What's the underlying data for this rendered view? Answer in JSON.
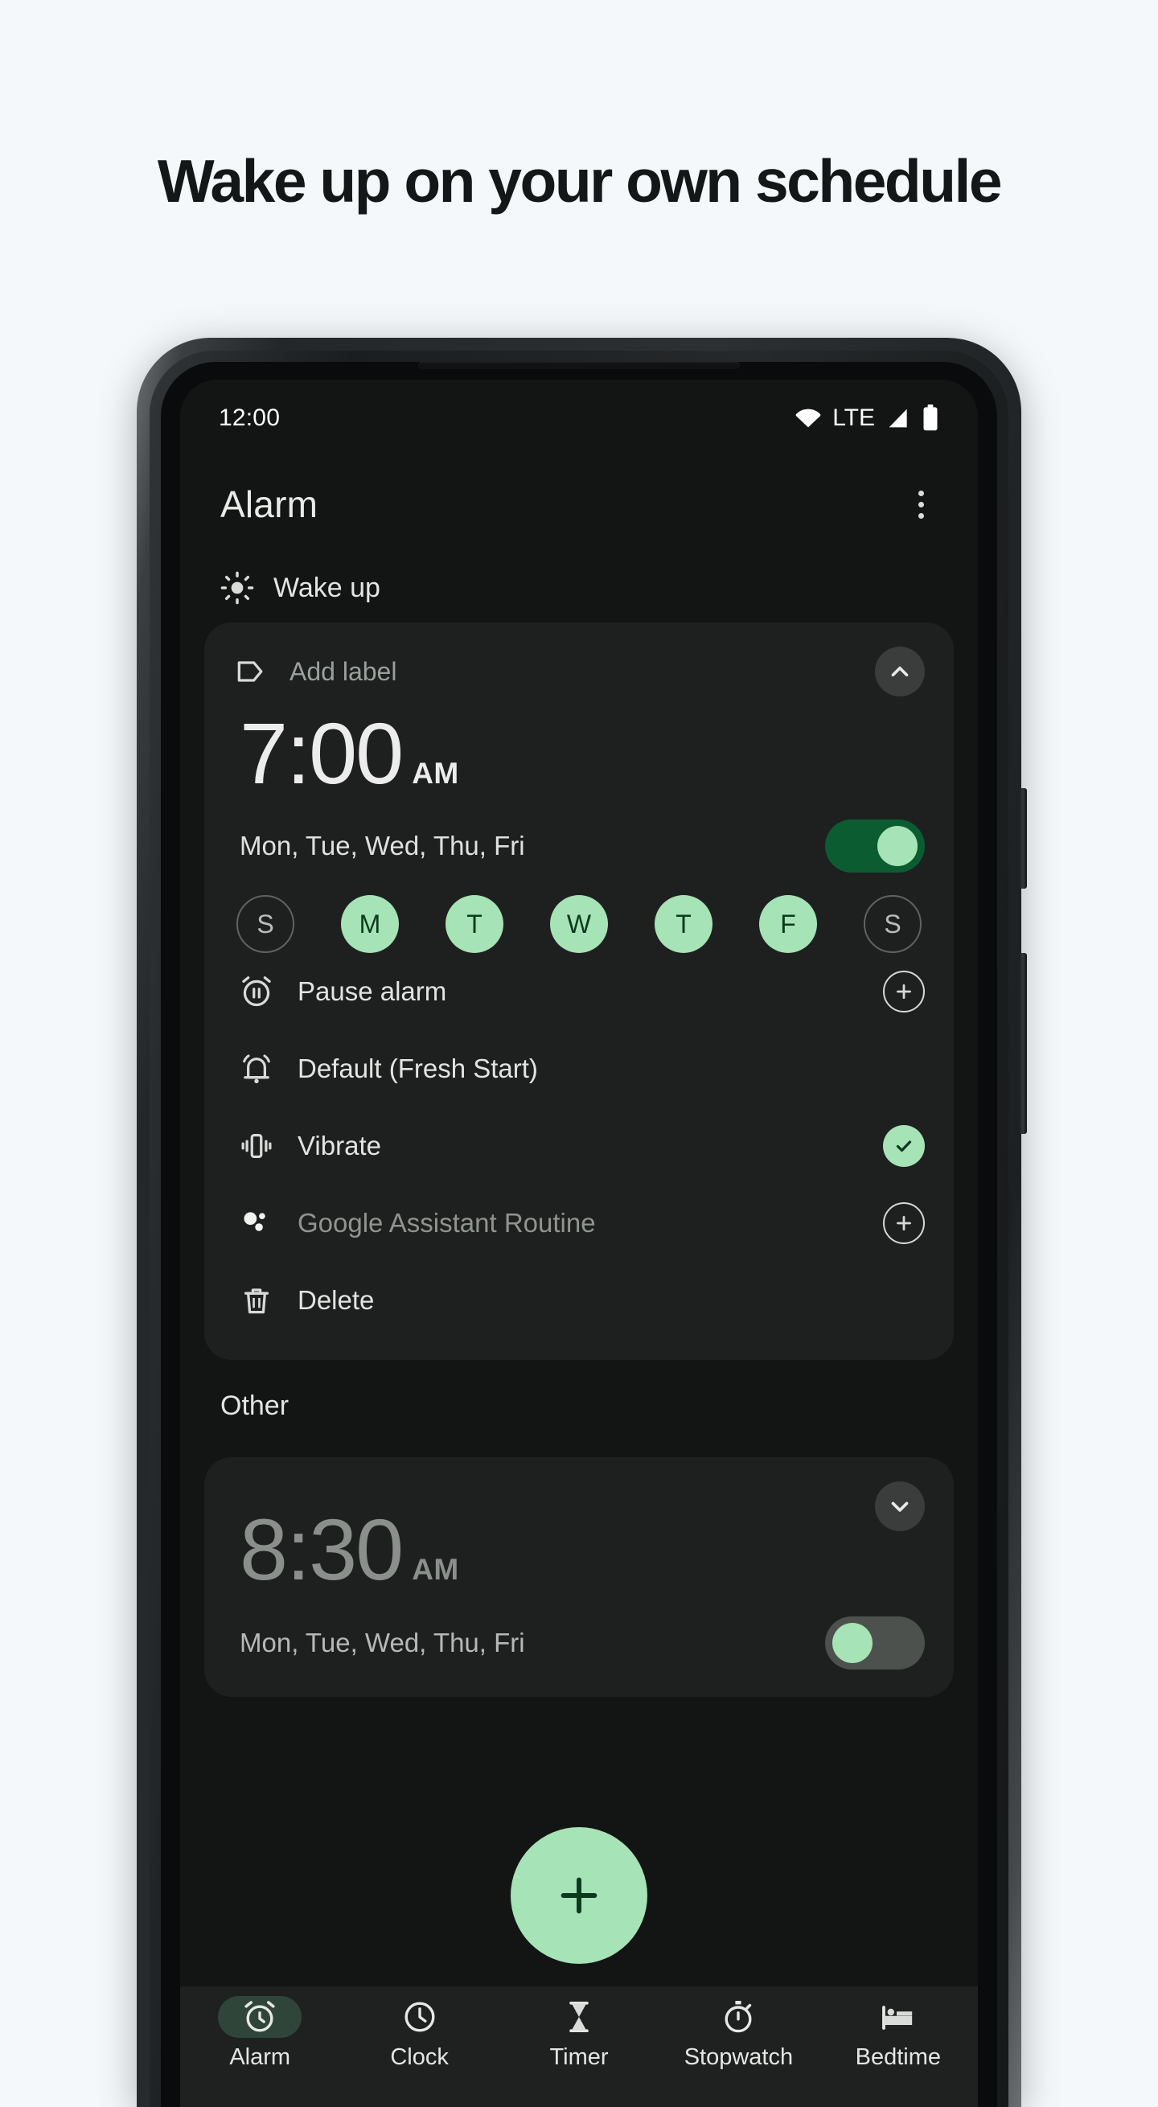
{
  "headline": "Wake up on your own schedule",
  "statusbar": {
    "time": "12:00",
    "network": "LTE",
    "icons": [
      "wifi-icon",
      "signal-icon",
      "battery-icon"
    ]
  },
  "appbar": {
    "title": "Alarm",
    "overflow_icon": "more-vertical-icon"
  },
  "groups": [
    {
      "icon": "sun-icon",
      "label": "Wake up"
    },
    {
      "label": "Other"
    }
  ],
  "alarm_primary": {
    "label_placeholder": "Add label",
    "label_icon": "tag-icon",
    "collapse_icon": "chevron-up-icon",
    "time": "7:00",
    "ampm": "AM",
    "days_summary": "Mon, Tue, Wed, Thu, Fri",
    "enabled": true,
    "day_pills": [
      {
        "letter": "S",
        "selected": false
      },
      {
        "letter": "M",
        "selected": true
      },
      {
        "letter": "T",
        "selected": true
      },
      {
        "letter": "W",
        "selected": true
      },
      {
        "letter": "T",
        "selected": true
      },
      {
        "letter": "F",
        "selected": true
      },
      {
        "letter": "S",
        "selected": false
      }
    ],
    "options": [
      {
        "icon": "alarm-pause-icon",
        "label": "Pause alarm",
        "trailing": "plus-circle-icon",
        "dim": false
      },
      {
        "icon": "bell-ring-icon",
        "label": "Default (Fresh Start)",
        "trailing": "none",
        "dim": false
      },
      {
        "icon": "vibrate-icon",
        "label": "Vibrate",
        "trailing": "check-circle-icon",
        "dim": false
      },
      {
        "icon": "google-assistant-icon",
        "label": "Google Assistant Routine",
        "trailing": "plus-circle-icon",
        "dim": true
      },
      {
        "icon": "trash-icon",
        "label": "Delete",
        "trailing": "none",
        "dim": false
      }
    ]
  },
  "alarm_secondary": {
    "time": "8:30",
    "ampm": "AM",
    "days_summary": "Mon, Tue, Wed, Thu, Fri",
    "enabled": false,
    "expand_icon": "chevron-down-icon"
  },
  "fab": {
    "icon": "plus-icon",
    "color": "#a6e3b6"
  },
  "bottomnav": {
    "items": [
      {
        "icon": "alarm-icon",
        "label": "Alarm",
        "active": true
      },
      {
        "icon": "clock-icon",
        "label": "Clock",
        "active": false
      },
      {
        "icon": "hourglass-icon",
        "label": "Timer",
        "active": false
      },
      {
        "icon": "stopwatch-icon",
        "label": "Stopwatch",
        "active": false
      },
      {
        "icon": "bed-icon",
        "label": "Bedtime",
        "active": false
      }
    ]
  },
  "colors": {
    "accent_green": "#a6e3b6",
    "toggle_on_track": "#0c5c31",
    "screen_bg": "#131514",
    "card_bg": "#1e201f",
    "page_bg": "#f4f8fa"
  }
}
